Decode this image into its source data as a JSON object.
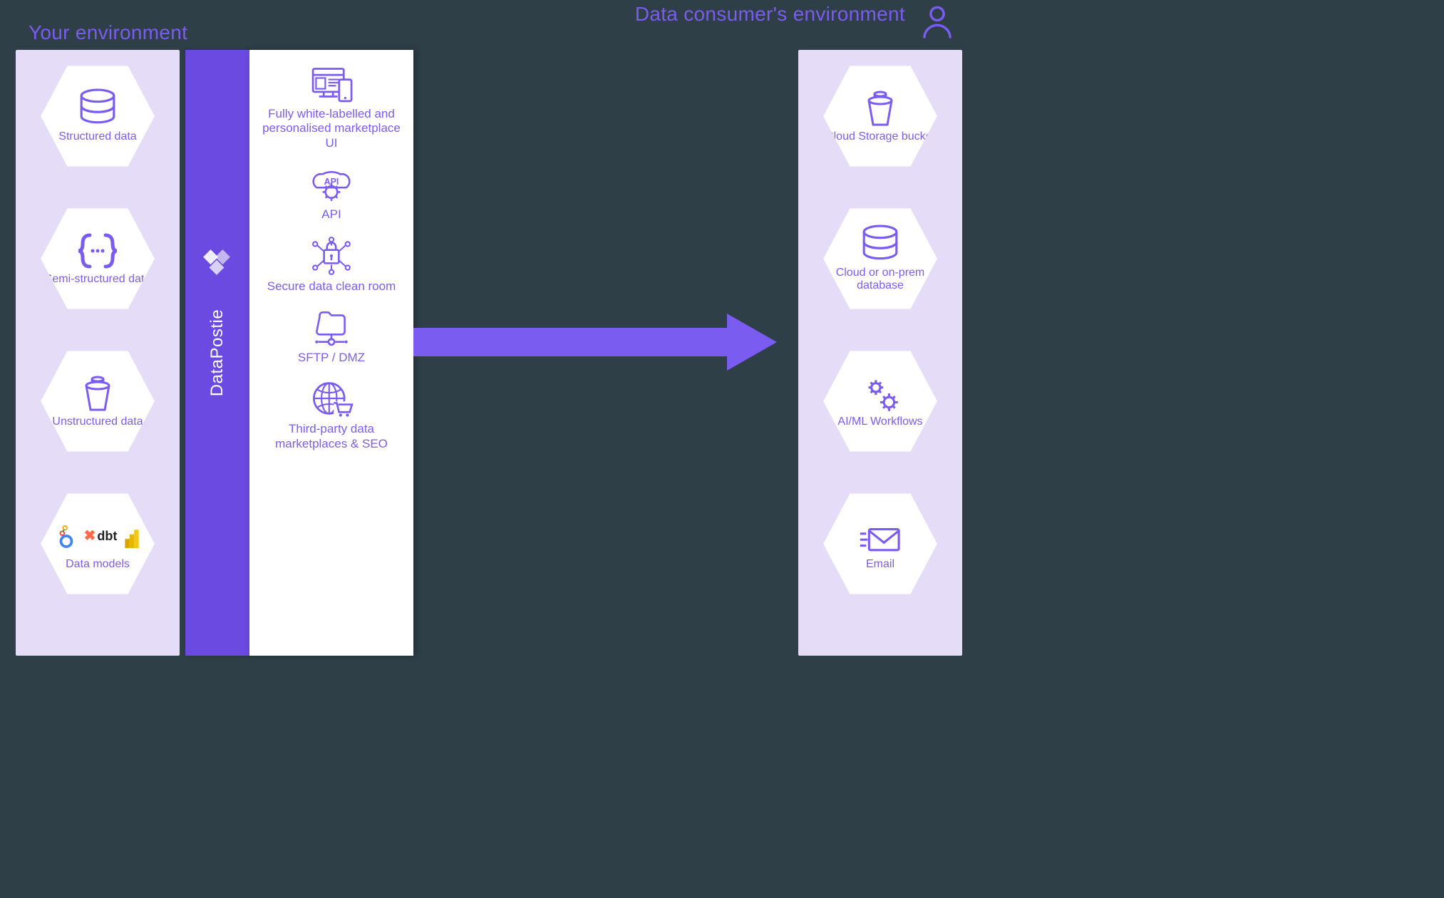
{
  "titles": {
    "left": "Your environment",
    "right": "Data consumer's environment"
  },
  "datapostie_label": "DataPostie",
  "left_items": [
    {
      "label": "Structured data",
      "icon": "database"
    },
    {
      "label": "Semi-structured data",
      "icon": "braces"
    },
    {
      "label": "Unstructured data",
      "icon": "bucket"
    },
    {
      "label": "Data models",
      "icon": "tools"
    }
  ],
  "outputs": [
    {
      "label": "Fully white-labelled and personalised marketplace UI",
      "icon": "devices"
    },
    {
      "label": "API",
      "icon": "api"
    },
    {
      "label": "Secure data clean room",
      "icon": "cleanroom"
    },
    {
      "label": "SFTP / DMZ",
      "icon": "sftp"
    },
    {
      "label": "Third-party data marketplaces & SEO",
      "icon": "globe-cart"
    }
  ],
  "right_items": [
    {
      "label": "Cloud Storage bucket",
      "icon": "bucket"
    },
    {
      "label": "Cloud or on-prem database",
      "icon": "database"
    },
    {
      "label": "AI/ML Workflows",
      "icon": "gears"
    },
    {
      "label": "Email",
      "icon": "email"
    }
  ],
  "tool_labels": {
    "dbt": "dbt"
  }
}
